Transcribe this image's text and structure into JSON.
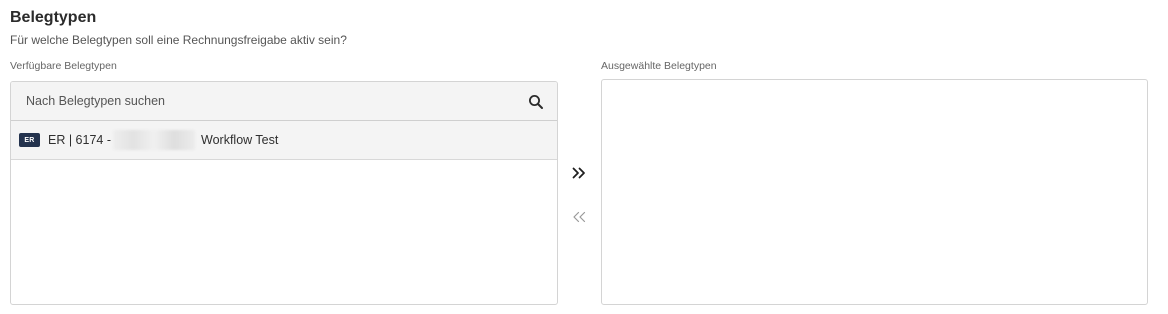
{
  "section": {
    "title": "Belegtypen",
    "description": "Für welche Belegtypen soll eine Rechnungsfreigabe aktiv sein?"
  },
  "available": {
    "label": "Verfügbare Belegtypen",
    "search_placeholder": "Nach Belegtypen suchen",
    "items": [
      {
        "badge": "ER",
        "text_prefix": "ER | 6174 -",
        "text_suffix": "Workflow Test"
      }
    ]
  },
  "selected": {
    "label": "Ausgewählte Belegtypen",
    "items": []
  },
  "buttons": {
    "move_right_icon": "double-chevron-right-icon",
    "move_left_icon": "double-chevron-left-icon"
  },
  "colors": {
    "badge_bg": "#23324d",
    "list_bg": "#f4f4f4",
    "border": "#d4d4d4"
  }
}
